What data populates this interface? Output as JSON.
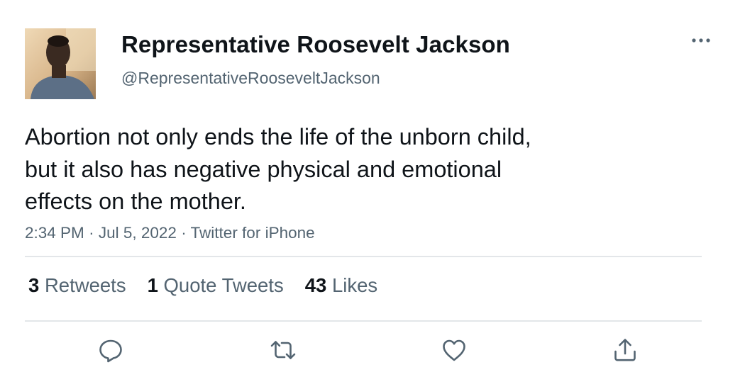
{
  "user": {
    "display_name": "Representative Roosevelt Jackson",
    "handle": "@RepresentativeRooseveltJackson",
    "avatar_icon": "profile-photo"
  },
  "tweet": {
    "lines": [
      "Abortion not only ends the life of the unborn child,",
      "but it also has negative physical and emotional",
      "effects on the mother."
    ],
    "time": "2:34 PM",
    "date": "Jul 5, 2022",
    "source": "Twitter for iPhone",
    "separator": "·"
  },
  "stats": {
    "retweets_count": "3",
    "retweets_label": "Retweets",
    "quotes_count": "1",
    "quotes_label": "Quote Tweets",
    "likes_count": "43",
    "likes_label": "Likes"
  },
  "icons": {
    "more": "more-icon",
    "reply": "reply-icon",
    "retweet": "retweet-icon",
    "like": "heart-icon",
    "share": "share-icon"
  },
  "colors": {
    "text": "#0f1419",
    "secondary": "#536471",
    "accent": "#1d9bf0",
    "divider": "#e3e6e9"
  }
}
